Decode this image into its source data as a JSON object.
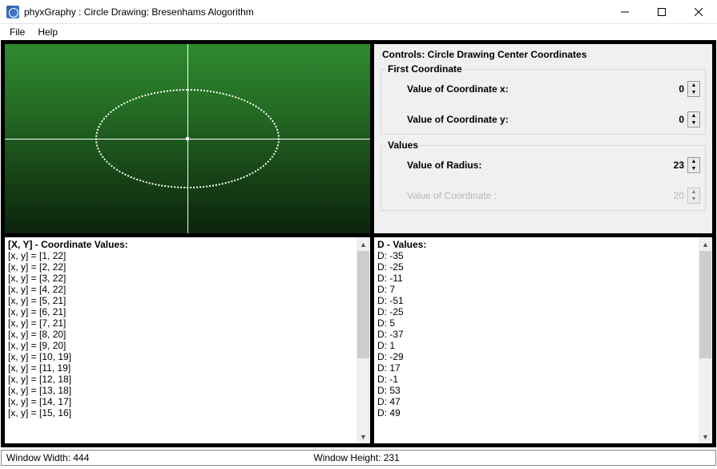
{
  "window": {
    "title": "phyxGraphy : Circle Drawing: Bresenhams Alogorithm"
  },
  "menu": {
    "file": "File",
    "help": "Help"
  },
  "controls": {
    "title": "Controls: Circle Drawing Center Coordinates",
    "group1": "First Coordinate",
    "x_label": "Value of Coordinate x:",
    "x_value": "0",
    "y_label": "Value of Coordinate y:",
    "y_value": "0",
    "group2": "Values",
    "r_label": "Value of Radius:",
    "r_value": "23",
    "d_label": "Value of Coordinate :",
    "d_value": "20"
  },
  "coord_list": {
    "title": "[X, Y] - Coordinate Values:",
    "items": [
      "[x, y] = [1, 22]",
      "[x, y] = [2, 22]",
      "[x, y] = [3, 22]",
      "[x, y] = [4, 22]",
      "[x, y] = [5, 21]",
      "[x, y] = [6, 21]",
      "[x, y] = [7, 21]",
      "[x, y] = [8, 20]",
      "[x, y] = [9, 20]",
      "[x, y] = [10, 19]",
      "[x, y] = [11, 19]",
      "[x, y] = [12, 18]",
      "[x, y] = [13, 18]",
      "[x, y] = [14, 17]",
      "[x, y] = [15, 16]"
    ]
  },
  "d_list": {
    "title": "D - Values:",
    "items": [
      "D: -35",
      "D: -25",
      "D: -11",
      "D: 7",
      "D: -51",
      "D: -25",
      "D: 5",
      "D: -37",
      "D: 1",
      "D: -29",
      "D: 17",
      "D: -1",
      "D: 53",
      "D: 47",
      "D: 49"
    ]
  },
  "status": {
    "width_label": "Window Width: 444",
    "height_label": "Window Height: 231"
  },
  "chart_data": {
    "type": "scatter",
    "title": "Bresenham circle, radius 23, center (0,0)",
    "points": [
      [
        1,
        22
      ],
      [
        2,
        22
      ],
      [
        3,
        22
      ],
      [
        4,
        22
      ],
      [
        5,
        21
      ],
      [
        6,
        21
      ],
      [
        7,
        21
      ],
      [
        8,
        20
      ],
      [
        9,
        20
      ],
      [
        10,
        19
      ],
      [
        11,
        19
      ],
      [
        12,
        18
      ],
      [
        13,
        18
      ],
      [
        14,
        17
      ],
      [
        15,
        16
      ]
    ],
    "d_values": [
      -35,
      -25,
      -11,
      7,
      -51,
      -25,
      5,
      -37,
      1,
      -29,
      17,
      -1,
      53,
      47,
      49
    ],
    "center": [
      0,
      0
    ],
    "radius": 23
  }
}
